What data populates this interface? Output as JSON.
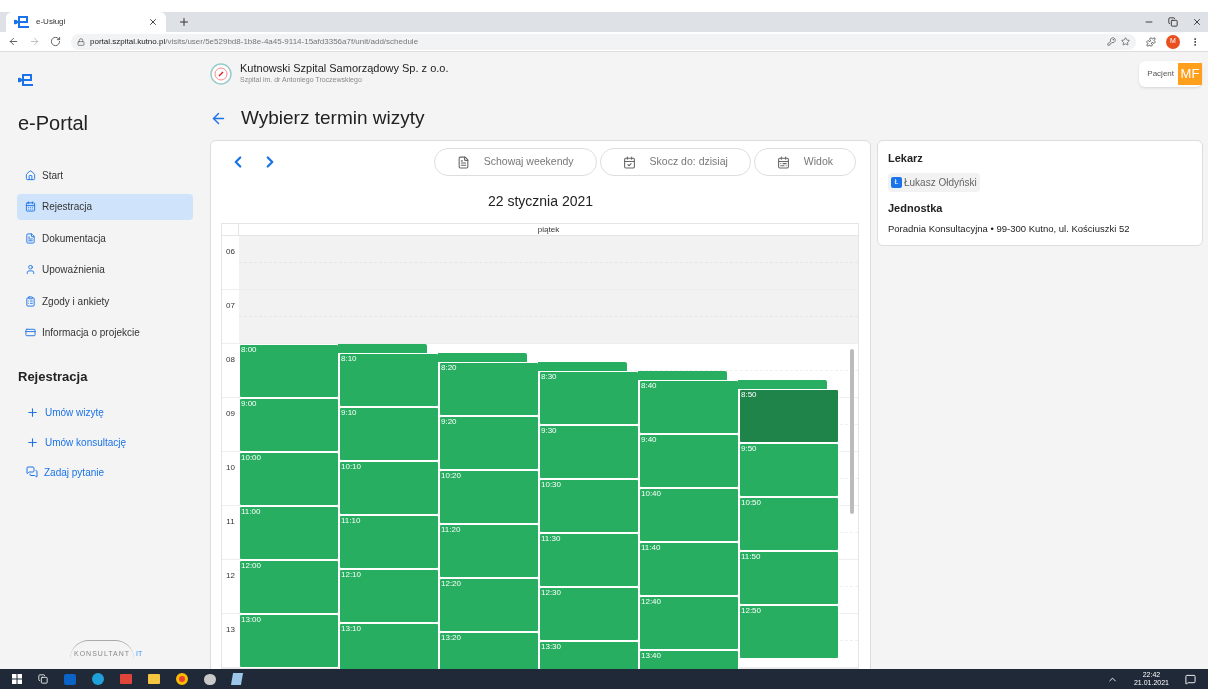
{
  "browser": {
    "tab_title": "e-Usługi",
    "url_host": "portal.szpital.kutno.pl",
    "url_path": "/visits/user/5e529bd8-1b8e-4a45-9114-15afd3356a7f/unit/add/schedule",
    "profile_initial": "M"
  },
  "sidebar": {
    "app_name": "e-Portal",
    "nav": [
      {
        "label": "Start",
        "selected": false
      },
      {
        "label": "Rejestracja",
        "selected": true
      },
      {
        "label": "Dokumentacja",
        "selected": false
      },
      {
        "label": "Upoważnienia",
        "selected": false
      },
      {
        "label": "Zgody i ankiety",
        "selected": false
      },
      {
        "label": "Informacja o projekcie",
        "selected": false
      }
    ],
    "section_title": "Rejestracja",
    "actions": [
      {
        "label": "Umów wizytę",
        "kind": "plus"
      },
      {
        "label": "Umów konsultację",
        "kind": "plus"
      },
      {
        "label": "Zadaj pytanie",
        "kind": "chat"
      }
    ],
    "footer_logo": [
      "KONSULTANT",
      "IT"
    ]
  },
  "header": {
    "hospital_name": "Kutnowski Szpital Samorządowy Sp. z o.o.",
    "hospital_subtitle": "Szpital im. dr Antoniego Troczewskiego",
    "user_role": "Pacjent",
    "user_initials": "MF"
  },
  "page_title": "Wybierz termin wizyty",
  "calendar": {
    "toolbar": [
      "Schowaj weekendy",
      "Skocz do: dzisiaj",
      "Widok"
    ],
    "date": "22 stycznia 2021",
    "day": "piątek",
    "hours": [
      "06",
      "07",
      "08",
      "09",
      "10",
      "11",
      "12",
      "13"
    ],
    "columns": [
      {
        "slots": [
          {
            "time": "8:00",
            "selected": false
          },
          {
            "time": "9:00",
            "selected": false
          },
          {
            "time": "10:00",
            "selected": false
          },
          {
            "time": "11:00",
            "selected": false
          },
          {
            "time": "12:00",
            "selected": false
          },
          {
            "time": "13:00",
            "selected": false
          }
        ]
      },
      {
        "slots": [
          {
            "time": "8:10",
            "selected": false
          },
          {
            "time": "9:10",
            "selected": false
          },
          {
            "time": "10:10",
            "selected": false
          },
          {
            "time": "11:10",
            "selected": false
          },
          {
            "time": "12:10",
            "selected": false
          },
          {
            "time": "13:10",
            "selected": false
          }
        ]
      },
      {
        "slots": [
          {
            "time": "8:20",
            "selected": false
          },
          {
            "time": "9:20",
            "selected": false
          },
          {
            "time": "10:20",
            "selected": false
          },
          {
            "time": "11:20",
            "selected": false
          },
          {
            "time": "12:20",
            "selected": false
          },
          {
            "time": "13:20",
            "selected": false
          }
        ]
      },
      {
        "slots": [
          {
            "time": "8:30",
            "selected": false
          },
          {
            "time": "9:30",
            "selected": false
          },
          {
            "time": "10:30",
            "selected": false
          },
          {
            "time": "11:30",
            "selected": false
          },
          {
            "time": "12:30",
            "selected": false
          },
          {
            "time": "13:30",
            "selected": false
          }
        ]
      },
      {
        "slots": [
          {
            "time": "8:40",
            "selected": false
          },
          {
            "time": "9:40",
            "selected": false
          },
          {
            "time": "10:40",
            "selected": false
          },
          {
            "time": "11:40",
            "selected": false
          },
          {
            "time": "12:40",
            "selected": false
          },
          {
            "time": "13:40",
            "selected": false
          }
        ]
      },
      {
        "slots": [
          {
            "time": "8:50",
            "selected": true
          },
          {
            "time": "9:50",
            "selected": false
          },
          {
            "time": "10:50",
            "selected": false
          },
          {
            "time": "11:50",
            "selected": false
          },
          {
            "time": "12:50",
            "selected": false
          }
        ]
      }
    ]
  },
  "details": {
    "doctor_heading": "Lekarz",
    "doctor_initial": "Ł",
    "doctor_name": "Łukasz Ołdyński",
    "unit_heading": "Jednostka",
    "unit": "Poradnia Konsultacyjna • 99-300 Kutno, ul. Kościuszki 52"
  },
  "taskbar": {
    "time": "22:42",
    "date": "21.01.2021"
  }
}
